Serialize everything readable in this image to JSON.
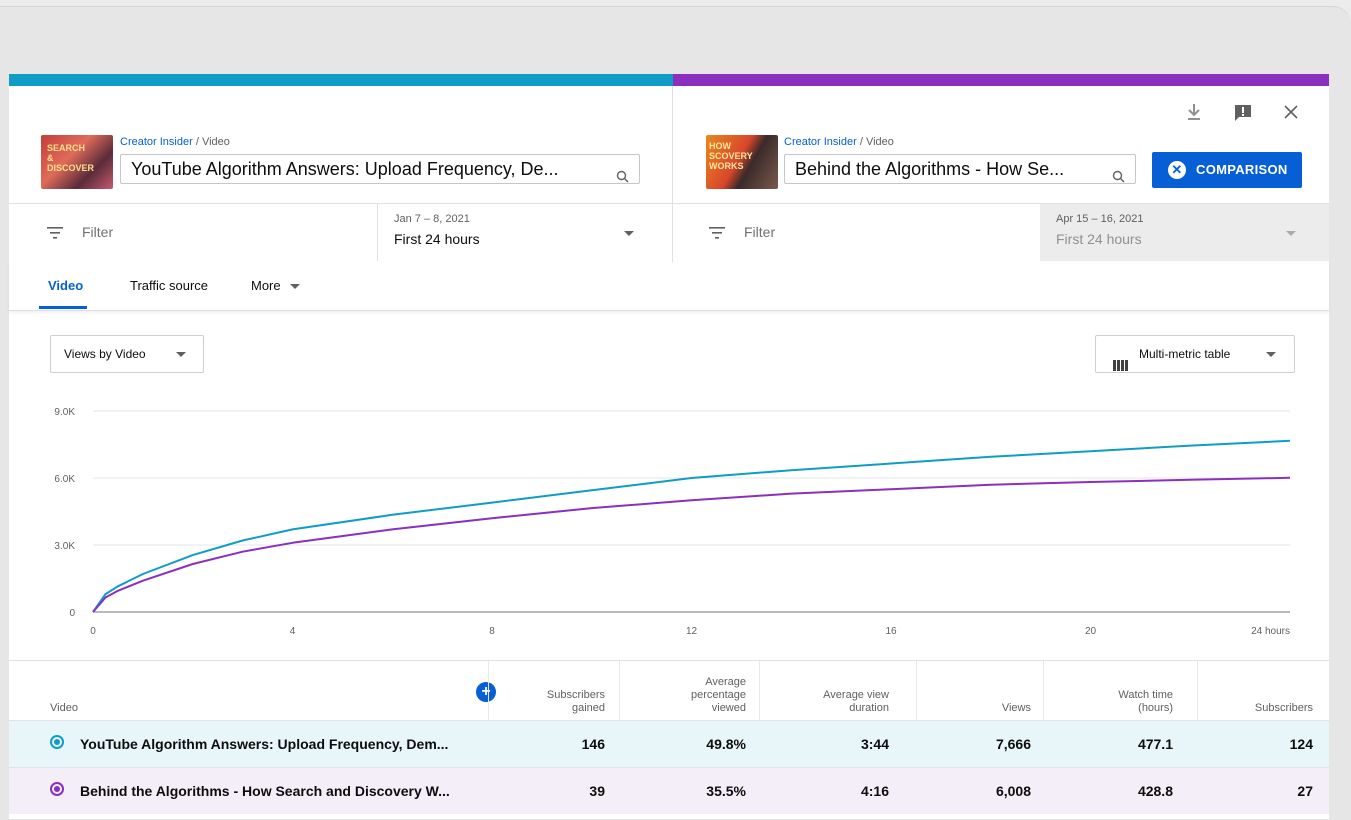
{
  "colors": {
    "series_a": "#0f9cc5",
    "series_b": "#8a2fc0",
    "accent": "#065fd4"
  },
  "left": {
    "thumb_text": "SEARCH\n&\nDISCOVER",
    "breadcrumb_channel": "Creator Insider",
    "breadcrumb_sep": "/",
    "breadcrumb_page": "Video",
    "video_title": "YouTube Algorithm Answers: Upload Frequency, De...",
    "filter_placeholder": "Filter",
    "date_range": "Jan 7 – 8, 2021",
    "date_period": "First 24 hours"
  },
  "right": {
    "thumb_text": "HOW\nSCOVERY\nWORKS",
    "breadcrumb_channel": "Creator Insider",
    "breadcrumb_sep": "/",
    "breadcrumb_page": "Video",
    "video_title": "Behind the Algorithms - How Se...",
    "filter_placeholder": "Filter",
    "date_range": "Apr 15 – 16, 2021",
    "date_period": "First 24 hours"
  },
  "toolbar": {
    "compare_label": "COMPARISON",
    "download_icon": "download-icon",
    "feedback_icon": "feedback-icon",
    "close_icon": "close-icon"
  },
  "tabs": [
    "Video",
    "Traffic source",
    "More"
  ],
  "metric_dropdown": "Views by Video",
  "view_dropdown": "Multi-metric table",
  "chart_data": {
    "type": "line",
    "x": [
      0,
      0.25,
      0.5,
      1,
      2,
      3,
      4,
      6,
      8,
      10,
      12,
      14,
      16,
      18,
      20,
      22,
      24
    ],
    "x_tick_labels": [
      "0",
      "4",
      "8",
      "12",
      "16",
      "20",
      "24 hours"
    ],
    "y_tick_labels": [
      "0",
      "3.0K",
      "6.0K",
      "9.0K"
    ],
    "ylim": [
      0,
      9000
    ],
    "xlim": [
      0,
      24
    ],
    "grid": true,
    "series": [
      {
        "values": [
          0,
          800,
          1150,
          1700,
          2550,
          3200,
          3700,
          4350,
          4900,
          5450,
          6000,
          6350,
          6650,
          6950,
          7200,
          7450,
          7666
        ]
      },
      {
        "values": [
          0,
          650,
          950,
          1400,
          2150,
          2700,
          3100,
          3700,
          4200,
          4650,
          5000,
          5300,
          5500,
          5700,
          5820,
          5920,
          6008
        ]
      }
    ]
  },
  "table": {
    "headers": {
      "video": "Video",
      "subs_gained": [
        "Subscribers",
        "gained"
      ],
      "avg_pct": [
        "Average",
        "percentage",
        "viewed"
      ],
      "avg_dur": [
        "Average view",
        "duration"
      ],
      "views": "Views",
      "watch": [
        "Watch time",
        "(hours)"
      ],
      "subs": "Subscribers"
    },
    "rows": [
      {
        "title": "YouTube Algorithm Answers: Upload Frequency, Dem...",
        "subs_gained": "146",
        "avg_pct": "49.8%",
        "avg_dur": "3:44",
        "views": "7,666",
        "watch": "477.1",
        "subs": "124"
      },
      {
        "title": "Behind the Algorithms - How Search and Discovery W...",
        "subs_gained": "39",
        "avg_pct": "35.5%",
        "avg_dur": "4:16",
        "views": "6,008",
        "watch": "428.8",
        "subs": "27"
      }
    ]
  }
}
